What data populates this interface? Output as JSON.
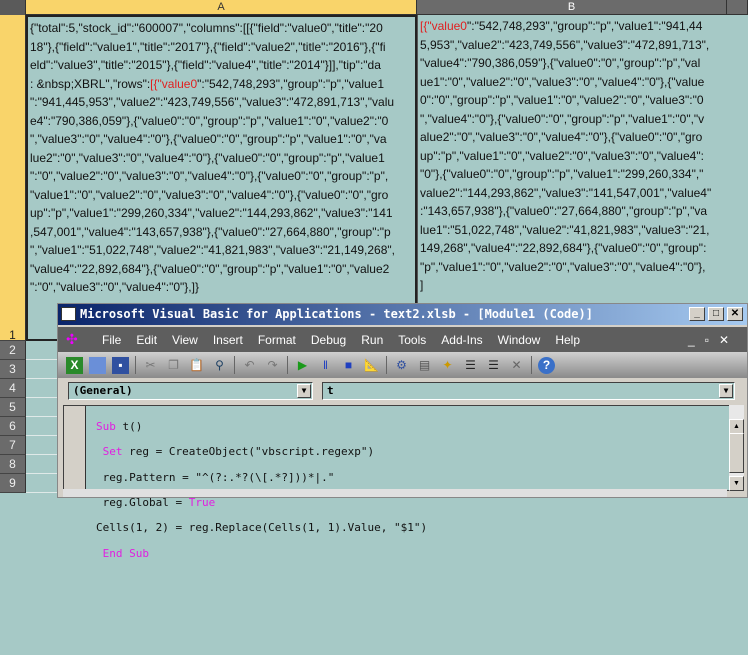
{
  "sheet": {
    "columns": [
      "A",
      "B"
    ],
    "rows": [
      "1",
      "2",
      "3",
      "4",
      "5",
      "6",
      "7",
      "8",
      "9"
    ],
    "cellA_prefix_line4": ": &nbsp;XBRL\",\"rows\":",
    "cellA_lines": [
      "{\"total\":5,\"stock_id\":\"600007\",\"columns\":[[{\"field\":\"value0\",\"title\":\"20",
      "18\"},{\"field\":\"value1\",\"title\":\"2017\"},{\"field\":\"value2\",\"title\":\"2016\"},{\"fi",
      "eld\":\"value3\",\"title\":\"2015\"},{\"field\":\"value4\",\"title\":\"2014\"}]],\"tip\":\"da",
      "\":\"542,748,293\",\"group\":\"p\",\"value1",
      "\":\"941,445,953\",\"value2\":\"423,749,556\",\"value3\":\"472,891,713\",\"valu",
      "e4\":\"790,386,059\"},{\"value0\":\"0\",\"group\":\"p\",\"value1\":\"0\",\"value2\":\"0",
      "\",\"value3\":\"0\",\"value4\":\"0\"},{\"value0\":\"0\",\"group\":\"p\",\"value1\":\"0\",\"va",
      "lue2\":\"0\",\"value3\":\"0\",\"value4\":\"0\"},{\"value0\":\"0\",\"group\":\"p\",\"value1",
      "\":\"0\",\"value2\":\"0\",\"value3\":\"0\",\"value4\":\"0\"},{\"value0\":\"0\",\"group\":\"p\",",
      "\"value1\":\"0\",\"value2\":\"0\",\"value3\":\"0\",\"value4\":\"0\"},{\"value0\":\"0\",\"gro",
      "up\":\"p\",\"value1\":\"299,260,334\",\"value2\":\"144,293,862\",\"value3\":\"141",
      ",547,001\",\"value4\":\"143,657,938\"},{\"value0\":\"27,664,880\",\"group\":\"p",
      "\",\"value1\":\"51,022,748\",\"value2\":\"41,821,983\",\"value3\":\"21,149,268\",",
      "\"value4\":\"22,892,684\"},{\"value0\":\"0\",\"group\":\"p\",\"value1\":\"0\",\"value2",
      "\":\"0\",\"value3\":\"0\",\"value4\":\"0\"},]}"
    ],
    "highlight": "[{\"value0",
    "cellB_lines": [
      "\":\"542,748,293\",\"group\":\"p\",\"value1\":\"941,44",
      "5,953\",\"value2\":\"423,749,556\",\"value3\":\"472,891,713\",",
      "\"value4\":\"790,386,059\"},{\"value0\":\"0\",\"group\":\"p\",\"val",
      "ue1\":\"0\",\"value2\":\"0\",\"value3\":\"0\",\"value4\":\"0\"},{\"value",
      "0\":\"0\",\"group\":\"p\",\"value1\":\"0\",\"value2\":\"0\",\"value3\":\"0",
      "\",\"value4\":\"0\"},{\"value0\":\"0\",\"group\":\"p\",\"value1\":\"0\",\"v",
      "alue2\":\"0\",\"value3\":\"0\",\"value4\":\"0\"},{\"value0\":\"0\",\"gro",
      "up\":\"p\",\"value1\":\"0\",\"value2\":\"0\",\"value3\":\"0\",\"value4\":",
      "\"0\"},{\"value0\":\"0\",\"group\":\"p\",\"value1\":\"299,260,334\",\"",
      "value2\":\"144,293,862\",\"value3\":\"141,547,001\",\"value4\"",
      ":\"143,657,938\"},{\"value0\":\"27,664,880\",\"group\":\"p\",\"va",
      "lue1\":\"51,022,748\",\"value2\":\"41,821,983\",\"value3\":\"21,",
      "149,268\",\"value4\":\"22,892,684\"},{\"value0\":\"0\",\"group\":",
      "\"p\",\"value1\":\"0\",\"value2\":\"0\",\"value3\":\"0\",\"value4\":\"0\"},",
      "]"
    ]
  },
  "vba": {
    "title": "Microsoft Visual Basic for Applications - text2.xlsb - [Module1 (Code)]",
    "menu": [
      "File",
      "Edit",
      "View",
      "Insert",
      "Format",
      "Debug",
      "Run",
      "Tools",
      "Add-Ins",
      "Window",
      "Help"
    ],
    "object_dropdown": "(General)",
    "proc_dropdown": "t",
    "code": {
      "l1_kw": "Sub",
      "l1": " t()",
      "l2_kw": " Set",
      "l2": " reg = CreateObject(\"vbscript.regexp\")",
      "l3": " reg.Pattern = \"^(?:.*?(\\[.*?]))*|.\"",
      "l4": " reg.Global = ",
      "l4_kw": "True",
      "l5": "Cells(1, 2) = reg.Replace(Cells(1, 1).Value, \"$1\")",
      "l6_kw": " End Sub"
    }
  }
}
